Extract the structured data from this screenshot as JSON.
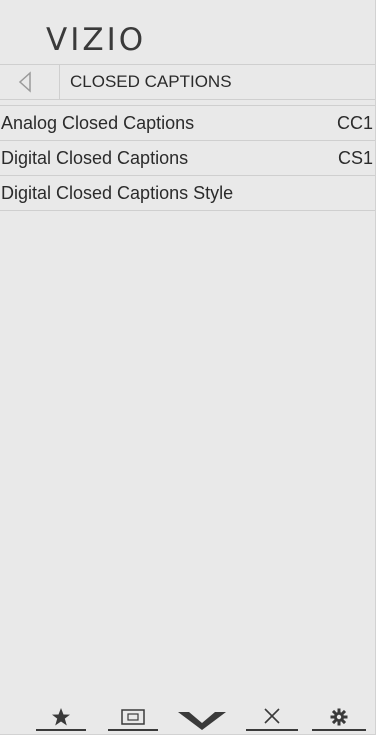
{
  "app": {
    "brand": "VIZIO"
  },
  "header": {
    "back_icon": "back-arrow-icon",
    "title": "CLOSED CAPTIONS"
  },
  "menu": {
    "items": [
      {
        "label": "Analog Closed Captions",
        "value": "CC1"
      },
      {
        "label": "Digital Closed Captions",
        "value": "CS1"
      },
      {
        "label": "Digital Closed Captions Style",
        "value": ""
      }
    ]
  },
  "bottom_bar": {
    "buttons": [
      {
        "icon": "star-icon"
      },
      {
        "icon": "input-icon"
      },
      {
        "icon": "vizio-v-icon"
      },
      {
        "icon": "close-icon"
      },
      {
        "icon": "gear-icon"
      }
    ]
  },
  "colors": {
    "panel_bg": "#e9e9e9",
    "divider": "#cfcfcf",
    "text": "#2b2b2b"
  }
}
